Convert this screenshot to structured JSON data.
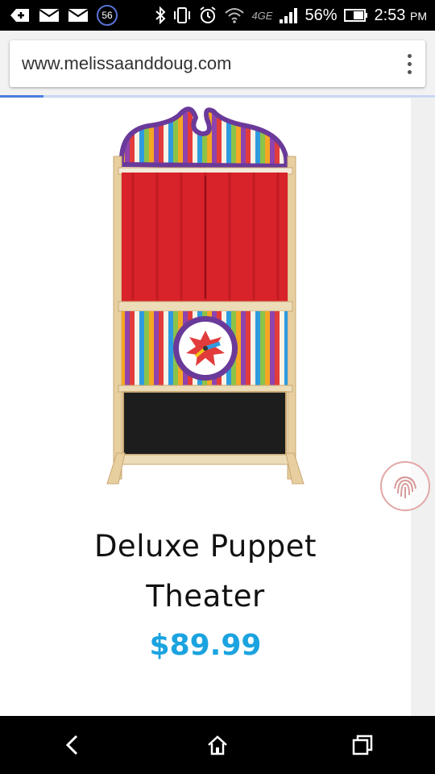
{
  "status_bar": {
    "notification_badge": "56",
    "network_label": "4GE",
    "battery_percent": "56%",
    "time": "2:53",
    "time_period": "PM",
    "icons": [
      "add-box-icon",
      "mail-icon",
      "mail-icon",
      "notification-count-icon",
      "bluetooth-icon",
      "vibrate-icon",
      "alarm-icon",
      "wifi-icon",
      "signal-icon",
      "battery-icon"
    ]
  },
  "browser": {
    "url": "www.melissaanddoug.com",
    "menu_icon": "more-vert-icon",
    "load_progress": 0.1
  },
  "product": {
    "title_line1": "Deluxe Puppet",
    "title_line2": "Theater",
    "price": "$89.99",
    "image_icon": "puppet-theater-image"
  },
  "overlay": {
    "fingerprint_icon": "fingerprint-icon"
  },
  "nav_bar": {
    "icons": [
      "back-icon",
      "home-icon",
      "recents-icon"
    ]
  },
  "colors": {
    "price": "#1ba3e0",
    "progress": "#4a7fe0",
    "curtain": "#d8232a",
    "frame_purple": "#6a3a9a"
  }
}
